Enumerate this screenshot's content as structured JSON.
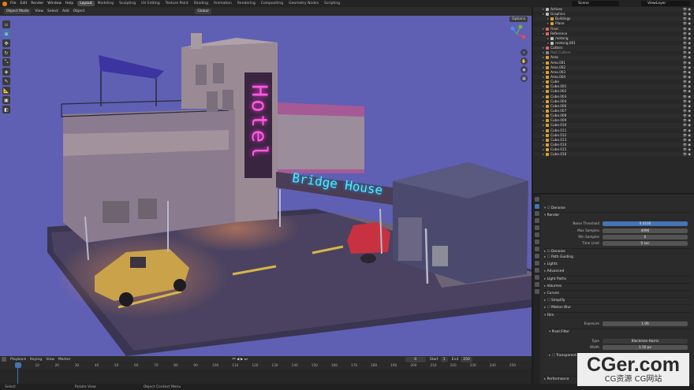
{
  "topbar": {
    "menus": [
      "File",
      "Edit",
      "Render",
      "Window",
      "Help"
    ],
    "workspaces": [
      "Layout",
      "Modeling",
      "Sculpting",
      "UV Editing",
      "Texture Paint",
      "Shading",
      "Animation",
      "Rendering",
      "Compositing",
      "Geometry Nodes",
      "Scripting"
    ],
    "active_workspace": "Layout",
    "scene": "Scene",
    "view_layer": "ViewLayer"
  },
  "viewport_header": {
    "mode": "Object Mode",
    "menus": [
      "View",
      "Select",
      "Add",
      "Object"
    ],
    "transform": "Global",
    "options": "Options"
  },
  "scene_labels": {
    "hotel": "Hotel",
    "bridge_house": "Bridge House"
  },
  "timeline": {
    "menus": [
      "Playback",
      "Keying",
      "View",
      "Marker"
    ],
    "current_frame": "0",
    "start_label": "Start",
    "start": "1",
    "end_label": "End",
    "end": "250",
    "ticks": [
      "0",
      "10",
      "20",
      "30",
      "40",
      "50",
      "60",
      "70",
      "80",
      "90",
      "100",
      "110",
      "120",
      "130",
      "140",
      "150",
      "160",
      "170",
      "180",
      "190",
      "200",
      "210",
      "220",
      "230",
      "240",
      "250"
    ]
  },
  "statusbar": {
    "select": "Select",
    "rotate": "Rotate View",
    "context": "Object Context Menu"
  },
  "outliner": {
    "rows": [
      {
        "name": "Actives",
        "color": "#bbbbbb",
        "indent": 1
      },
      {
        "name": "Graphics",
        "color": "#bbbbbb",
        "indent": 1
      },
      {
        "name": "Buildings",
        "color": "#e0a030",
        "indent": 2
      },
      {
        "name": "Plane",
        "color": "#e0a030",
        "indent": 2
      },
      {
        "name": "Final",
        "color": "#e06666",
        "indent": 1
      },
      {
        "name": "Reference",
        "color": "#e06666",
        "indent": 1
      },
      {
        "name": "metarig",
        "color": "#bbbbbb",
        "indent": 2
      },
      {
        "name": "metarig.001",
        "color": "#bbbbbb",
        "indent": 2
      },
      {
        "name": "Cutters",
        "color": "#e06666",
        "indent": 1
      },
      {
        "name": "Post Cutters",
        "color": "#888888",
        "indent": 1
      },
      {
        "name": "Area",
        "color": "#e0a030",
        "indent": 1
      },
      {
        "name": "Area.001",
        "color": "#e0a030",
        "indent": 1
      },
      {
        "name": "Area.002",
        "color": "#e0a030",
        "indent": 1
      },
      {
        "name": "Area.003",
        "color": "#e0a030",
        "indent": 1
      },
      {
        "name": "Area.004",
        "color": "#e0a030",
        "indent": 1
      },
      {
        "name": "Cube",
        "color": "#e0a030",
        "indent": 1
      },
      {
        "name": "Cube.001",
        "color": "#e0a030",
        "indent": 1
      },
      {
        "name": "Cube.002",
        "color": "#e0a030",
        "indent": 1
      },
      {
        "name": "Cube.003",
        "color": "#e0a030",
        "indent": 1
      },
      {
        "name": "Cube.004",
        "color": "#e0a030",
        "indent": 1
      },
      {
        "name": "Cube.006",
        "color": "#e0a030",
        "indent": 1
      },
      {
        "name": "Cube.007",
        "color": "#e0a030",
        "indent": 1
      },
      {
        "name": "Cube.008",
        "color": "#e0a030",
        "indent": 1
      },
      {
        "name": "Cube.009",
        "color": "#e0a030",
        "indent": 1
      },
      {
        "name": "Cube.010",
        "color": "#e0a030",
        "indent": 1
      },
      {
        "name": "Cube.011",
        "color": "#e0a030",
        "indent": 1
      },
      {
        "name": "Cube.012",
        "color": "#e0a030",
        "indent": 1
      },
      {
        "name": "Cube.013",
        "color": "#e0a030",
        "indent": 1
      },
      {
        "name": "Cube.014",
        "color": "#e0a030",
        "indent": 1
      },
      {
        "name": "Cube.015",
        "color": "#e0a030",
        "indent": 1
      },
      {
        "name": "Cube.016",
        "color": "#e0a030",
        "indent": 1
      }
    ]
  },
  "properties": {
    "denoise_top": "Denoise",
    "render_section": "Render",
    "noise_threshold_label": "Noise Threshold",
    "noise_threshold": "0.0100",
    "max_samples_label": "Max Samples",
    "max_samples": "4096",
    "min_samples_label": "Min Samples",
    "min_samples": "0",
    "time_limit_label": "Time Limit",
    "time_limit": "0 sec",
    "denoise": "Denoise",
    "path_guiding": "Path Guiding",
    "lights": "Lights",
    "advanced": "Advanced",
    "light_paths": "Light Paths",
    "volumes": "Volumes",
    "curves": "Curves",
    "simplify": "Simplify",
    "motion_blur": "Motion Blur",
    "film": "Film",
    "exposure_label": "Exposure",
    "exposure": "1.00",
    "pixel_filter": "Pixel Filter",
    "type_label": "Type",
    "type": "Blackman-Harris",
    "width_label": "Width",
    "width": "1.50 px",
    "transparent": "Transparent",
    "performance": "Performance"
  },
  "watermark": {
    "main": "CGer.com",
    "sub": "CG资源 CG网站"
  }
}
